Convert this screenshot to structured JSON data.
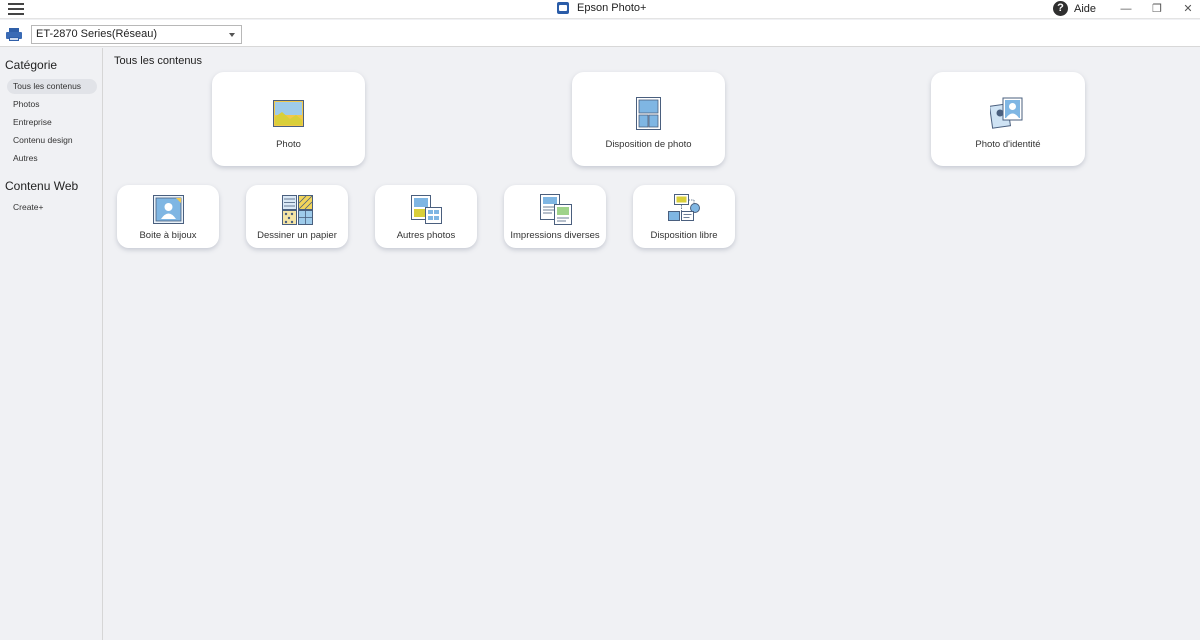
{
  "window": {
    "app_title": "Epson Photo+",
    "help_label": "Aide",
    "menu_icon": "hamburger-icon",
    "app_icon": "epson-photo-icon",
    "controls": [
      "minimize-icon",
      "restore-icon",
      "close-icon"
    ]
  },
  "toolbar": {
    "printer_select_value": "ET-2870 Series(Réseau)"
  },
  "sidebar": {
    "category_heading": "Catégorie",
    "items": [
      {
        "label": "Tous les contenus",
        "active": true
      },
      {
        "label": "Photos",
        "active": false
      },
      {
        "label": "Entreprise",
        "active": false
      },
      {
        "label": "Contenu design",
        "active": false
      },
      {
        "label": "Autres",
        "active": false
      }
    ],
    "web_heading": "Contenu Web",
    "web_items": [
      {
        "label": "Create+"
      }
    ]
  },
  "main": {
    "title": "Tous les contenus",
    "large_cards": [
      {
        "label": "Photo",
        "icon": "photo-icon"
      },
      {
        "label": "Disposition de photo",
        "icon": "photo-layout-icon"
      },
      {
        "label": "Photo d'identité",
        "icon": "id-photo-icon"
      }
    ],
    "small_cards": [
      {
        "label": "Boite à bijoux",
        "icon": "jewel-case-icon"
      },
      {
        "label": "Dessiner un papier",
        "icon": "design-paper-icon"
      },
      {
        "label": "Autres photos",
        "icon": "other-photos-icon"
      },
      {
        "label": "Impressions diverses",
        "icon": "various-prints-icon"
      },
      {
        "label": "Disposition libre",
        "icon": "free-layout-icon"
      }
    ]
  },
  "colors": {
    "accent": "#3a6bb5",
    "background": "#f0f1f4",
    "card": "#ffffff"
  }
}
